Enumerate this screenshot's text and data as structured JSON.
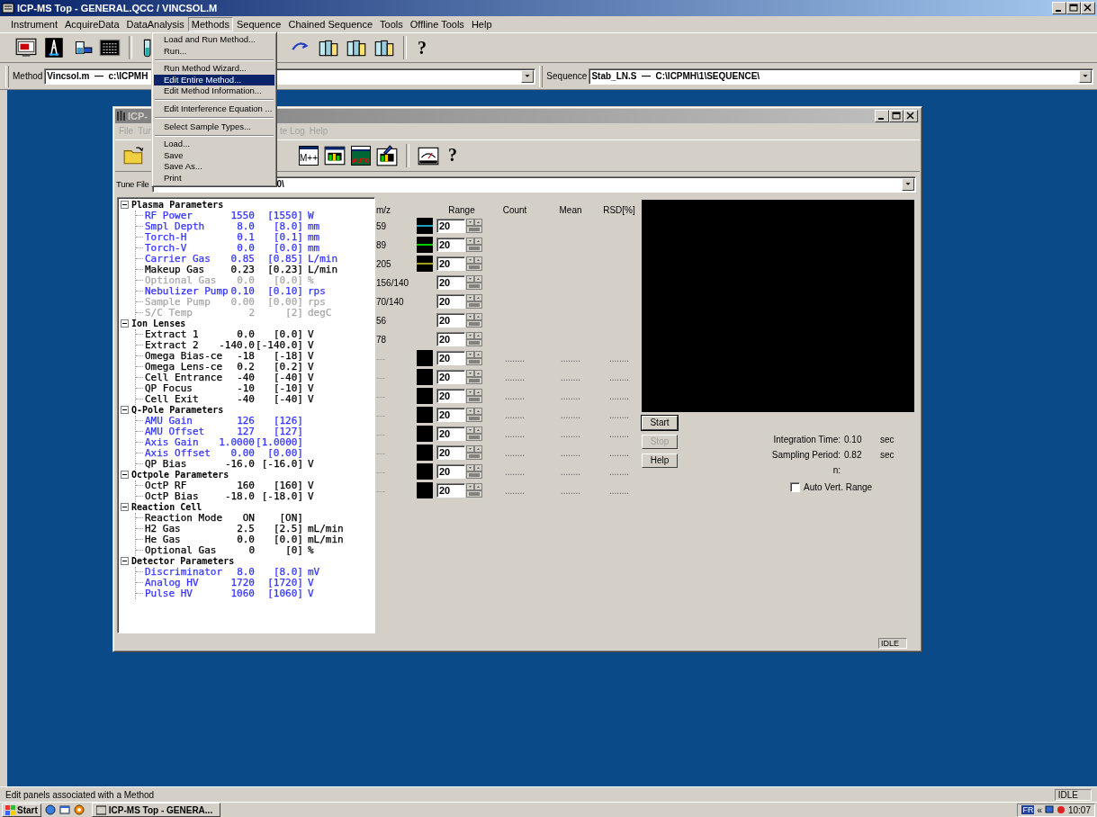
{
  "window": {
    "title": "ICP-MS Top - GENERAL.QCC / VINCSOL.M"
  },
  "menu": [
    {
      "label": "Instrument",
      "selected": false
    },
    {
      "label": "AcquireData",
      "selected": false
    },
    {
      "label": "DataAnalysis",
      "selected": false
    },
    {
      "label": "Methods",
      "selected": true
    },
    {
      "label": "Sequence",
      "selected": false
    },
    {
      "label": "Chained Sequence",
      "selected": false
    },
    {
      "label": "Tools",
      "selected": false
    },
    {
      "label": "Offline Tools",
      "selected": false
    },
    {
      "label": "Help",
      "selected": false
    }
  ],
  "methods_menu": [
    {
      "kind": "item",
      "label": "Load and Run Method...",
      "selected": false
    },
    {
      "kind": "item",
      "label": "Run...",
      "selected": false
    },
    {
      "kind": "separator"
    },
    {
      "kind": "item",
      "label": "Run Method Wizard...",
      "selected": false
    },
    {
      "kind": "item",
      "label": "Edit Entire Method...",
      "selected": true
    },
    {
      "kind": "item",
      "label": "Edit Method Information...",
      "selected": false
    },
    {
      "kind": "separator"
    },
    {
      "kind": "item",
      "label": "Edit Interference Equation ...",
      "selected": false
    },
    {
      "kind": "separator"
    },
    {
      "kind": "item",
      "label": "Select Sample Types...",
      "selected": false
    },
    {
      "kind": "separator"
    },
    {
      "kind": "item",
      "label": "Load...",
      "selected": false
    },
    {
      "kind": "item",
      "label": "Save",
      "selected": false
    },
    {
      "kind": "item",
      "label": "Save As...",
      "selected": false
    },
    {
      "kind": "item",
      "label": "Print",
      "selected": false
    }
  ],
  "toolbar_left": [
    {
      "kind": "screen"
    },
    {
      "kind": "tower"
    },
    {
      "kind": "beaker"
    },
    {
      "kind": "panel"
    },
    {
      "kind": "separator"
    },
    {
      "kind": "tube"
    }
  ],
  "toolbar_right": [
    {
      "kind": "arrow"
    },
    {
      "kind": "bottles"
    },
    {
      "kind": "bottles"
    },
    {
      "kind": "bottles"
    },
    {
      "kind": "separator"
    },
    {
      "kind": "help",
      "label": "?"
    }
  ],
  "method_bar": {
    "method_label": "Method",
    "method_value": "Vincsol.m  —  c:\\ICPMH",
    "sequence_label": "Sequence",
    "sequence_value": "Stab_LN.S  —  C:\\ICPMH\\1\\SEQUENCE\\"
  },
  "tune_window": {
    "title": "ICP-",
    "menu_left": [
      {
        "label": "File",
        "disabled": true
      },
      {
        "label": "Tun",
        "disabled": true
      }
    ],
    "menu_right": [
      {
        "label": "te Log",
        "disabled": true
      },
      {
        "label": "Help",
        "disabled": true
      }
    ],
    "toolbar_left": [
      {
        "kind": "folder"
      }
    ],
    "toolbar_right": [
      {
        "kind": "text-window",
        "label": "M++"
      },
      {
        "kind": "bars"
      },
      {
        "kind": "auto",
        "label": "AUTO"
      },
      {
        "kind": "bars-pen"
      },
      {
        "kind": "separator"
      },
      {
        "kind": "meter"
      },
      {
        "kind": "help",
        "label": "?"
      }
    ],
    "tune_file_label": "Tune File",
    "tune_file_value": "0\\",
    "tree": [
      {
        "label": "Plasma Parameters",
        "expanded": true,
        "children": [
          {
            "name": "RF Power",
            "value": "1550",
            "setpoint": "[1550]",
            "unit": "W",
            "color": "#3333ff"
          },
          {
            "name": "Smpl Depth",
            "value": "8.0",
            "setpoint": "[8.0]",
            "unit": "mm",
            "color": "#3333ff"
          },
          {
            "name": "Torch-H",
            "value": "0.1",
            "setpoint": "[0.1]",
            "unit": "mm",
            "color": "#3333ff"
          },
          {
            "name": "Torch-V",
            "value": "0.0",
            "setpoint": "[0.0]",
            "unit": "mm",
            "color": "#3333ff"
          },
          {
            "name": "Carrier Gas",
            "value": "0.85",
            "setpoint": "[0.85]",
            "unit": "L/min",
            "color": "#3333ff"
          },
          {
            "name": "Makeup Gas",
            "value": "0.23",
            "setpoint": "[0.23]",
            "unit": "L/min",
            "color": "#000000"
          },
          {
            "name": "Optional Gas",
            "value": "0.0",
            "setpoint": "[0.0]",
            "unit": "%",
            "color": "#a8a8a8"
          },
          {
            "name": "Nebulizer Pump",
            "value": "0.10",
            "setpoint": "[0.10]",
            "unit": "rps",
            "color": "#3333ff"
          },
          {
            "name": "Sample Pump",
            "value": "0.00",
            "setpoint": "[0.00]",
            "unit": "rps",
            "color": "#a8a8a8"
          },
          {
            "name": "S/C Temp",
            "value": "2",
            "setpoint": "[2]",
            "unit": "degC",
            "color": "#a8a8a8"
          }
        ]
      },
      {
        "label": "Ion Lenses",
        "expanded": true,
        "children": [
          {
            "name": "Extract 1",
            "value": "0.0",
            "setpoint": "[0.0]",
            "unit": "V",
            "color": "#000000"
          },
          {
            "name": "Extract 2",
            "value": "-140.0",
            "setpoint": "[-140.0]",
            "unit": "V",
            "color": "#000000"
          },
          {
            "name": "Omega Bias-ce",
            "value": "-18",
            "setpoint": "[-18]",
            "unit": "V",
            "color": "#000000"
          },
          {
            "name": "Omega Lens-ce",
            "value": "0.2",
            "setpoint": "[0.2]",
            "unit": "V",
            "color": "#000000"
          },
          {
            "name": "Cell Entrance",
            "value": "-40",
            "setpoint": "[-40]",
            "unit": "V",
            "color": "#000000"
          },
          {
            "name": "QP Focus",
            "value": "-10",
            "setpoint": "[-10]",
            "unit": "V",
            "color": "#000000"
          },
          {
            "name": "Cell Exit",
            "value": "-40",
            "setpoint": "[-40]",
            "unit": "V",
            "color": "#000000"
          }
        ]
      },
      {
        "label": "Q-Pole Parameters",
        "expanded": true,
        "children": [
          {
            "name": "AMU Gain",
            "value": "126",
            "setpoint": "[126]",
            "color": "#3333ff"
          },
          {
            "name": "AMU Offset",
            "value": "127",
            "setpoint": "[127]",
            "color": "#3333ff"
          },
          {
            "name": "Axis Gain",
            "value": "1.0000",
            "setpoint": "[1.0000]",
            "color": "#3333ff"
          },
          {
            "name": "Axis Offset",
            "value": "0.00",
            "setpoint": "[0.00]",
            "color": "#3333ff"
          },
          {
            "name": "QP Bias",
            "value": "-16.0",
            "setpoint": "[-16.0]",
            "unit": "V",
            "color": "#000000"
          }
        ]
      },
      {
        "label": "Octpole Parameters",
        "expanded": true,
        "children": [
          {
            "name": "OctP RF",
            "value": "160",
            "setpoint": "[160]",
            "unit": "V",
            "color": "#000000"
          },
          {
            "name": "OctP Bias",
            "value": "-18.0",
            "setpoint": "[-18.0]",
            "unit": "V",
            "color": "#000000"
          }
        ]
      },
      {
        "label": "Reaction Cell",
        "expanded": true,
        "children": [
          {
            "name": "Reaction Mode",
            "value": "ON",
            "setpoint": "[ON]",
            "color": "#000000"
          },
          {
            "name": "H2 Gas",
            "value": "2.5",
            "setpoint": "[2.5]",
            "unit": "mL/min",
            "color": "#000000"
          },
          {
            "name": "He Gas",
            "value": "0.0",
            "setpoint": "[0.0]",
            "unit": "mL/min",
            "color": "#000000"
          },
          {
            "name": "Optional Gas",
            "value": "0",
            "setpoint": "[0]",
            "unit": "%",
            "color": "#000000"
          }
        ]
      },
      {
        "label": "Detector Parameters",
        "expanded": true,
        "children": [
          {
            "name": "Discriminator",
            "value": "8.0",
            "setpoint": "[8.0]",
            "unit": "mV",
            "color": "#3333ff"
          },
          {
            "name": "Analog HV",
            "value": "1720",
            "setpoint": "[1720]",
            "unit": "V",
            "color": "#3333ff"
          },
          {
            "name": "Pulse HV",
            "value": "1060",
            "setpoint": "[1060]",
            "unit": "V",
            "color": "#3333ff"
          }
        ]
      }
    ],
    "monitor": {
      "columns": [
        "m/z",
        "Range",
        "Count",
        "Mean",
        "RSD[%]"
      ],
      "rows": [
        {
          "kind": "trace",
          "mz": "59",
          "color": "#20a0c0",
          "range": "20"
        },
        {
          "kind": "trace",
          "mz": "89",
          "color": "#00d000",
          "range": "20"
        },
        {
          "kind": "trace",
          "mz": "205",
          "color": "#a0a020",
          "range": "20"
        },
        {
          "kind": "ratio",
          "mz": "156/140",
          "range": "20"
        },
        {
          "kind": "ratio",
          "mz": "70/140",
          "range": "20"
        },
        {
          "kind": "ratio",
          "mz": "56",
          "range": "20"
        },
        {
          "kind": "ratio",
          "mz": "78",
          "range": "20"
        },
        {
          "kind": "empty",
          "mz": "---",
          "range": "20",
          "count": "........",
          "mean": "........",
          "rsd": "........"
        },
        {
          "kind": "empty",
          "mz": "---",
          "range": "20",
          "count": "........",
          "mean": "........",
          "rsd": "........"
        },
        {
          "kind": "empty",
          "mz": "---",
          "range": "20",
          "count": "........",
          "mean": "........",
          "rsd": "........"
        },
        {
          "kind": "empty",
          "mz": "---",
          "range": "20",
          "count": "........",
          "mean": "........",
          "rsd": "........"
        },
        {
          "kind": "empty",
          "mz": "---",
          "range": "20",
          "count": "........",
          "mean": "........",
          "rsd": "........"
        },
        {
          "kind": "empty",
          "mz": "---",
          "range": "20",
          "count": "........",
          "mean": "........",
          "rsd": "........"
        },
        {
          "kind": "empty",
          "mz": "---",
          "range": "20",
          "count": "........",
          "mean": "........",
          "rsd": "........"
        },
        {
          "kind": "empty",
          "mz": "---",
          "range": "20",
          "count": "........",
          "mean": "........",
          "rsd": "........"
        }
      ]
    },
    "buttons": [
      {
        "label": "Start",
        "disabled": false
      },
      {
        "label": "Stop",
        "disabled": true
      },
      {
        "label": "Help",
        "disabled": false
      }
    ],
    "info": [
      {
        "label": "Integration Time:",
        "value": "0.10",
        "unit": "sec"
      },
      {
        "label": "Sampling Period:",
        "value": "0.82",
        "unit": "sec"
      },
      {
        "label": "n:"
      }
    ],
    "auto_vert_range": {
      "label": "Auto Vert. Range",
      "checked": false
    },
    "status": "IDLE"
  },
  "status_bar": {
    "text": "Edit panels associated with a Method",
    "state": "IDLE"
  },
  "taskbar": {
    "start": "Start",
    "windows": [
      {
        "label": "ICP-MS Top - GENERA...",
        "selected": false
      }
    ],
    "language": "FR",
    "chevron": "«",
    "clock": "10:07"
  }
}
